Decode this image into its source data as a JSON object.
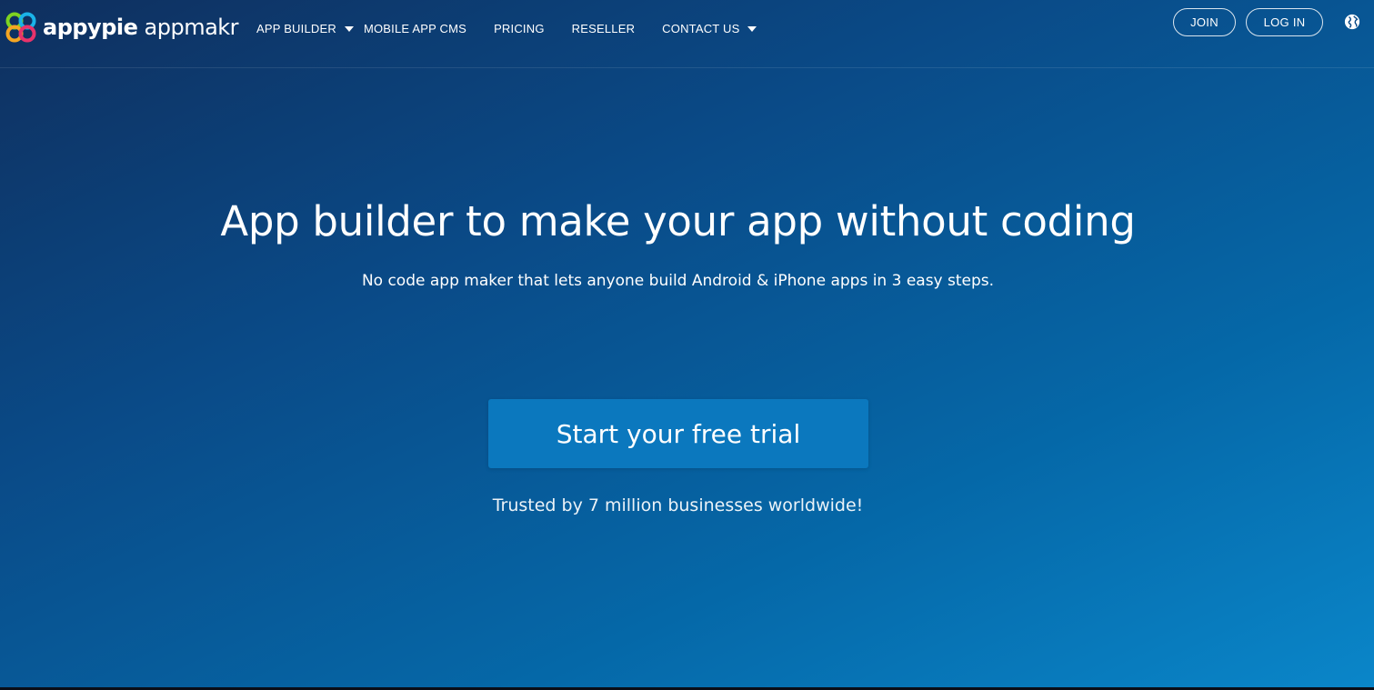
{
  "brand": {
    "name_bold": "appypie",
    "name_light": " appmakr",
    "logo_icon": "appypie-logo-icon"
  },
  "nav": {
    "items": [
      {
        "label": "APP BUILDER",
        "has_dropdown": true
      },
      {
        "label": "MOBILE APP CMS",
        "has_dropdown": false
      },
      {
        "label": "PRICING",
        "has_dropdown": false
      },
      {
        "label": "RESELLER",
        "has_dropdown": false
      },
      {
        "label": "CONTACT US",
        "has_dropdown": true
      }
    ]
  },
  "auth": {
    "join_label": "JOIN",
    "login_label": "LOG IN",
    "language_icon": "globe-icon"
  },
  "hero": {
    "title": "App builder to make your app without coding",
    "subtitle": "No code app maker that lets anyone build Android & iPhone apps in 3 easy steps.",
    "cta_label": "Start your free trial",
    "trust_text": "Trusted by 7 million businesses worldwide!"
  },
  "colors": {
    "gradient_start": "#0f2f5e",
    "gradient_end": "#0a86c9",
    "cta_background": "#0b78be",
    "text": "#ffffff"
  }
}
